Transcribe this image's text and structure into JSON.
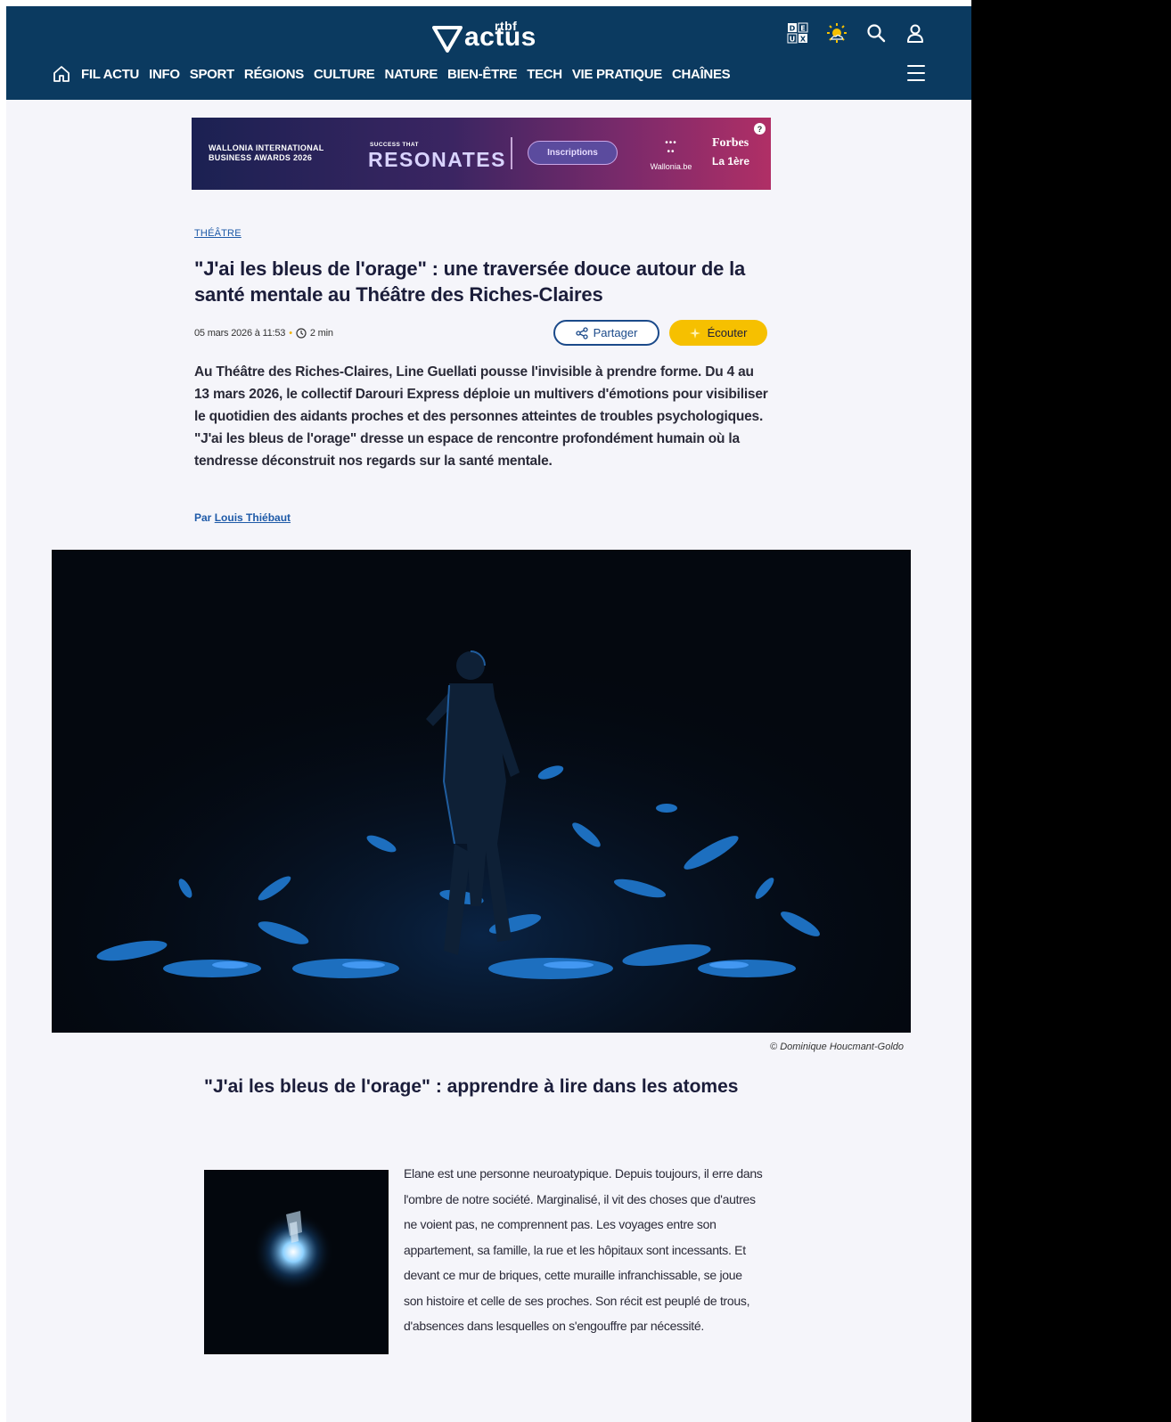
{
  "header": {
    "logo_small": "rtbf",
    "logo_main": "actus",
    "icons": [
      "dyslexia-icon",
      "weather-sun-icon",
      "search-icon",
      "user-icon"
    ],
    "nav": [
      "FIL ACTU",
      "INFO",
      "SPORT",
      "RÉGIONS",
      "CULTURE",
      "NATURE",
      "BIEN-ÊTRE",
      "TECH",
      "VIE PRATIQUE",
      "CHAÎNES"
    ],
    "colors": {
      "background": "#0b3a60",
      "text": "#ffffff"
    }
  },
  "ad": {
    "left_text_line1": "WALLONIA INTERNATIONAL",
    "left_text_line2": "BUSINESS AWARDS 2026",
    "tagline_small": "SUCCESS THAT",
    "tagline_big": "RESONATES",
    "button": "Inscriptions",
    "partner1": "Wallonia.be",
    "partner2": "Forbes",
    "partner3": "La 1ère",
    "info": "?"
  },
  "article": {
    "category": "THÉÂTRE",
    "title": "\"J'ai les bleus de l'orage\" : une traversée douce autour de la santé mentale au Théâtre des Riches-Claires",
    "date": "05 mars 2026 à 11:53",
    "separator": "•",
    "read_time": "2 min",
    "share_label": "Partager",
    "listen_label": "Écouter",
    "lead": "Au Théâtre des Riches-Claires, Line Guellati pousse l'invisible à prendre forme. Du 4 au 13 mars 2026, le collectif Darouri Express déploie un multivers d'émotions pour visibiliser le quotidien des aidants proches et des personnes atteintes de troubles psychologiques. \"J'ai les bleus de l'orage\" dresse un espace de rencontre profondément humain où la tendresse déconstruit nos regards sur la santé mentale.",
    "author_prefix": "Par",
    "author": "Louis Thiébaut",
    "image_credit": "© Dominique Houcmant-Goldo",
    "subtitle": "\"J'ai les bleus de l'orage\" : apprendre à lire dans les atomes",
    "body": "Elane est une personne neuroatypique. Depuis toujours, il erre dans l'ombre de notre société. Marginalisé, il vit des choses que d'autres ne voient pas, ne comprennent pas. Les voyages entre son appartement, sa famille, la rue et les hôpitaux sont incessants. Et devant ce mur de briques, cette muraille infranchissable, se joue son histoire et celle de ses proches. Son récit est peuplé de trous, d'absences dans lesquelles on s'engouffre par nécessité.",
    "colors": {
      "accent": "#f6c000",
      "link": "#1e5aa8",
      "title": "#1b1d3a"
    }
  }
}
